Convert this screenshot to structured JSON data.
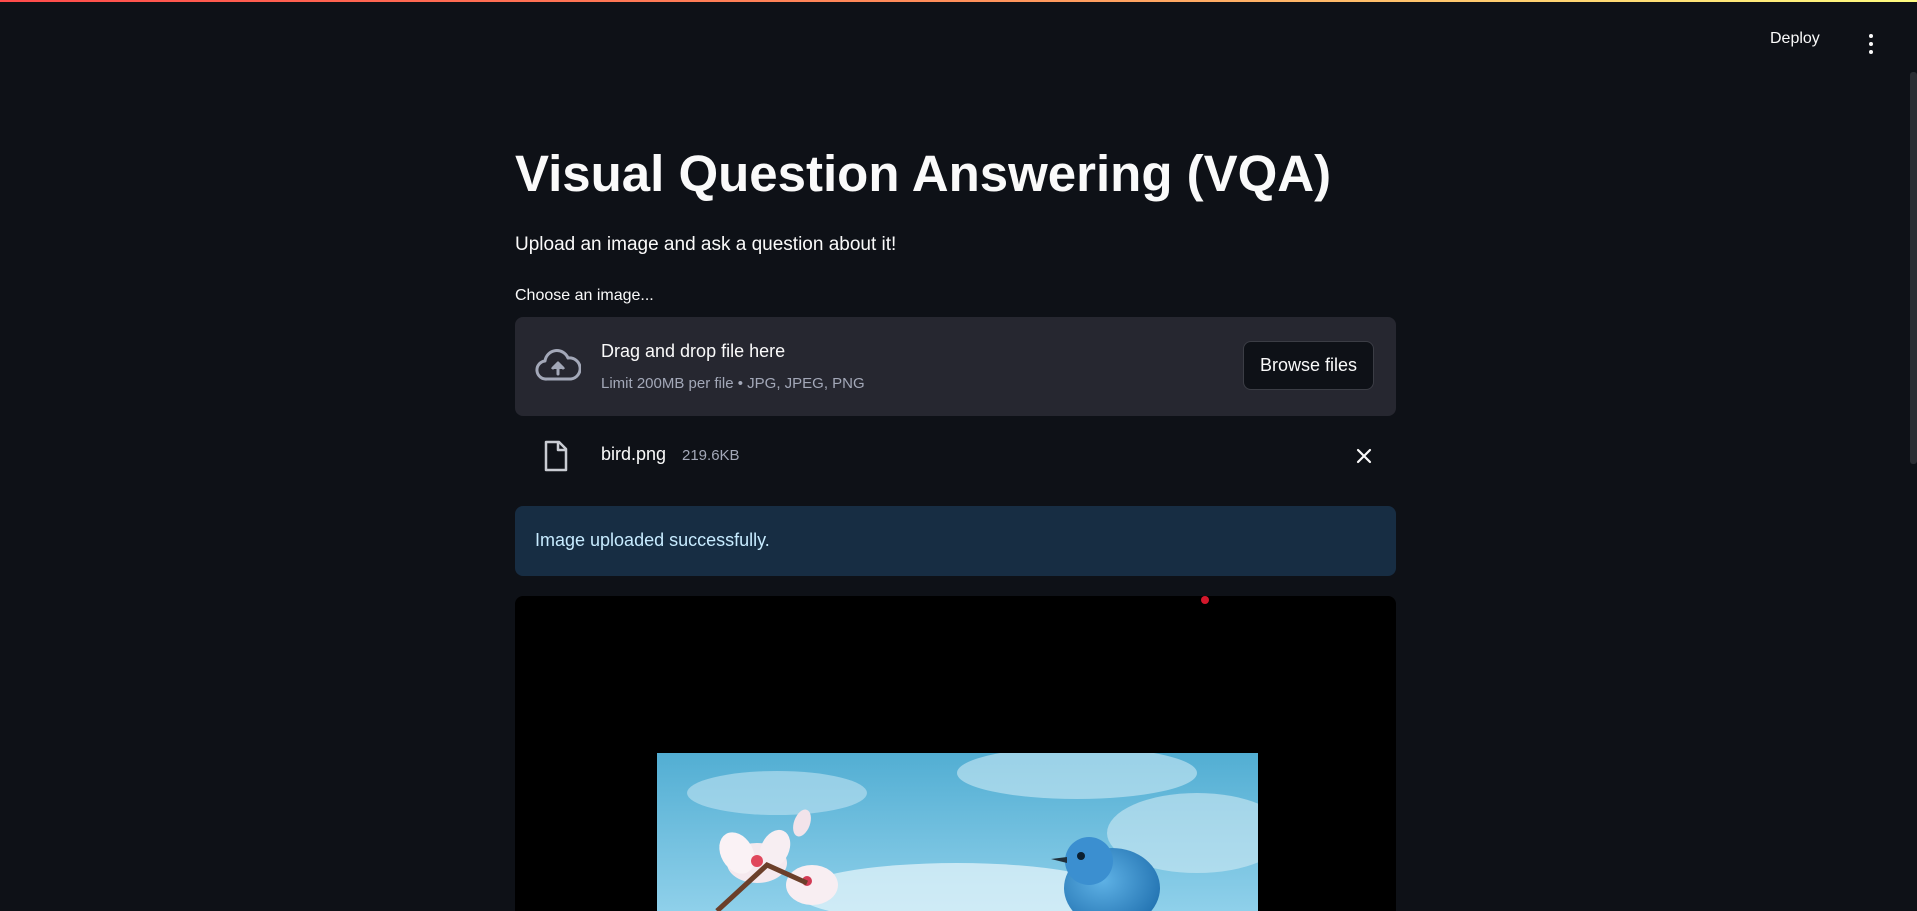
{
  "header": {
    "deploy_label": "Deploy",
    "menu_icon": "vertical-dots-icon"
  },
  "main": {
    "title": "Visual Question Answering (VQA)",
    "subtitle": "Upload an image and ask a question about it!",
    "uploader": {
      "label": "Choose an image...",
      "drop_text": "Drag and drop file here",
      "limit_text": "Limit 200MB per file • JPG, JPEG, PNG",
      "browse_label": "Browse files",
      "icon": "cloud-upload-icon"
    },
    "uploaded_file": {
      "name": "bird.png",
      "size": "219.6KB",
      "icon": "file-icon",
      "remove_icon": "close-icon"
    },
    "alert": {
      "text": "Image uploaded successfully."
    }
  },
  "colors": {
    "background": "#0e1117",
    "dropzone": "#262730",
    "info_bg": "#172d43",
    "info_text": "#c7ebff",
    "accent": "#ff4b4b"
  }
}
